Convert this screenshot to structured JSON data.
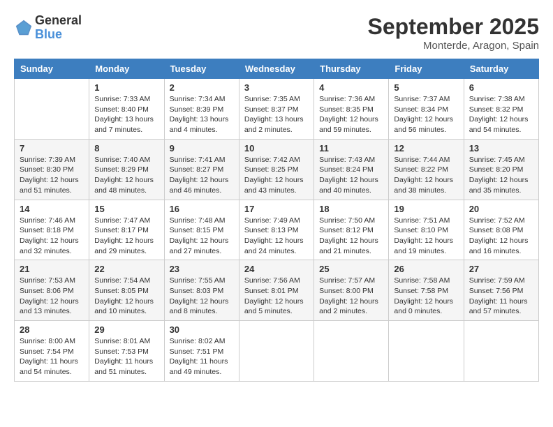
{
  "logo": {
    "general": "General",
    "blue": "Blue"
  },
  "title": "September 2025",
  "location": "Monterde, Aragon, Spain",
  "weekdays": [
    "Sunday",
    "Monday",
    "Tuesday",
    "Wednesday",
    "Thursday",
    "Friday",
    "Saturday"
  ],
  "weeks": [
    [
      {
        "day": "",
        "sunrise": "",
        "sunset": "",
        "daylight": ""
      },
      {
        "day": "1",
        "sunrise": "Sunrise: 7:33 AM",
        "sunset": "Sunset: 8:40 PM",
        "daylight": "Daylight: 13 hours and 7 minutes."
      },
      {
        "day": "2",
        "sunrise": "Sunrise: 7:34 AM",
        "sunset": "Sunset: 8:39 PM",
        "daylight": "Daylight: 13 hours and 4 minutes."
      },
      {
        "day": "3",
        "sunrise": "Sunrise: 7:35 AM",
        "sunset": "Sunset: 8:37 PM",
        "daylight": "Daylight: 13 hours and 2 minutes."
      },
      {
        "day": "4",
        "sunrise": "Sunrise: 7:36 AM",
        "sunset": "Sunset: 8:35 PM",
        "daylight": "Daylight: 12 hours and 59 minutes."
      },
      {
        "day": "5",
        "sunrise": "Sunrise: 7:37 AM",
        "sunset": "Sunset: 8:34 PM",
        "daylight": "Daylight: 12 hours and 56 minutes."
      },
      {
        "day": "6",
        "sunrise": "Sunrise: 7:38 AM",
        "sunset": "Sunset: 8:32 PM",
        "daylight": "Daylight: 12 hours and 54 minutes."
      }
    ],
    [
      {
        "day": "7",
        "sunrise": "Sunrise: 7:39 AM",
        "sunset": "Sunset: 8:30 PM",
        "daylight": "Daylight: 12 hours and 51 minutes."
      },
      {
        "day": "8",
        "sunrise": "Sunrise: 7:40 AM",
        "sunset": "Sunset: 8:29 PM",
        "daylight": "Daylight: 12 hours and 48 minutes."
      },
      {
        "day": "9",
        "sunrise": "Sunrise: 7:41 AM",
        "sunset": "Sunset: 8:27 PM",
        "daylight": "Daylight: 12 hours and 46 minutes."
      },
      {
        "day": "10",
        "sunrise": "Sunrise: 7:42 AM",
        "sunset": "Sunset: 8:25 PM",
        "daylight": "Daylight: 12 hours and 43 minutes."
      },
      {
        "day": "11",
        "sunrise": "Sunrise: 7:43 AM",
        "sunset": "Sunset: 8:24 PM",
        "daylight": "Daylight: 12 hours and 40 minutes."
      },
      {
        "day": "12",
        "sunrise": "Sunrise: 7:44 AM",
        "sunset": "Sunset: 8:22 PM",
        "daylight": "Daylight: 12 hours and 38 minutes."
      },
      {
        "day": "13",
        "sunrise": "Sunrise: 7:45 AM",
        "sunset": "Sunset: 8:20 PM",
        "daylight": "Daylight: 12 hours and 35 minutes."
      }
    ],
    [
      {
        "day": "14",
        "sunrise": "Sunrise: 7:46 AM",
        "sunset": "Sunset: 8:18 PM",
        "daylight": "Daylight: 12 hours and 32 minutes."
      },
      {
        "day": "15",
        "sunrise": "Sunrise: 7:47 AM",
        "sunset": "Sunset: 8:17 PM",
        "daylight": "Daylight: 12 hours and 29 minutes."
      },
      {
        "day": "16",
        "sunrise": "Sunrise: 7:48 AM",
        "sunset": "Sunset: 8:15 PM",
        "daylight": "Daylight: 12 hours and 27 minutes."
      },
      {
        "day": "17",
        "sunrise": "Sunrise: 7:49 AM",
        "sunset": "Sunset: 8:13 PM",
        "daylight": "Daylight: 12 hours and 24 minutes."
      },
      {
        "day": "18",
        "sunrise": "Sunrise: 7:50 AM",
        "sunset": "Sunset: 8:12 PM",
        "daylight": "Daylight: 12 hours and 21 minutes."
      },
      {
        "day": "19",
        "sunrise": "Sunrise: 7:51 AM",
        "sunset": "Sunset: 8:10 PM",
        "daylight": "Daylight: 12 hours and 19 minutes."
      },
      {
        "day": "20",
        "sunrise": "Sunrise: 7:52 AM",
        "sunset": "Sunset: 8:08 PM",
        "daylight": "Daylight: 12 hours and 16 minutes."
      }
    ],
    [
      {
        "day": "21",
        "sunrise": "Sunrise: 7:53 AM",
        "sunset": "Sunset: 8:06 PM",
        "daylight": "Daylight: 12 hours and 13 minutes."
      },
      {
        "day": "22",
        "sunrise": "Sunrise: 7:54 AM",
        "sunset": "Sunset: 8:05 PM",
        "daylight": "Daylight: 12 hours and 10 minutes."
      },
      {
        "day": "23",
        "sunrise": "Sunrise: 7:55 AM",
        "sunset": "Sunset: 8:03 PM",
        "daylight": "Daylight: 12 hours and 8 minutes."
      },
      {
        "day": "24",
        "sunrise": "Sunrise: 7:56 AM",
        "sunset": "Sunset: 8:01 PM",
        "daylight": "Daylight: 12 hours and 5 minutes."
      },
      {
        "day": "25",
        "sunrise": "Sunrise: 7:57 AM",
        "sunset": "Sunset: 8:00 PM",
        "daylight": "Daylight: 12 hours and 2 minutes."
      },
      {
        "day": "26",
        "sunrise": "Sunrise: 7:58 AM",
        "sunset": "Sunset: 7:58 PM",
        "daylight": "Daylight: 12 hours and 0 minutes."
      },
      {
        "day": "27",
        "sunrise": "Sunrise: 7:59 AM",
        "sunset": "Sunset: 7:56 PM",
        "daylight": "Daylight: 11 hours and 57 minutes."
      }
    ],
    [
      {
        "day": "28",
        "sunrise": "Sunrise: 8:00 AM",
        "sunset": "Sunset: 7:54 PM",
        "daylight": "Daylight: 11 hours and 54 minutes."
      },
      {
        "day": "29",
        "sunrise": "Sunrise: 8:01 AM",
        "sunset": "Sunset: 7:53 PM",
        "daylight": "Daylight: 11 hours and 51 minutes."
      },
      {
        "day": "30",
        "sunrise": "Sunrise: 8:02 AM",
        "sunset": "Sunset: 7:51 PM",
        "daylight": "Daylight: 11 hours and 49 minutes."
      },
      {
        "day": "",
        "sunrise": "",
        "sunset": "",
        "daylight": ""
      },
      {
        "day": "",
        "sunrise": "",
        "sunset": "",
        "daylight": ""
      },
      {
        "day": "",
        "sunrise": "",
        "sunset": "",
        "daylight": ""
      },
      {
        "day": "",
        "sunrise": "",
        "sunset": "",
        "daylight": ""
      }
    ]
  ]
}
